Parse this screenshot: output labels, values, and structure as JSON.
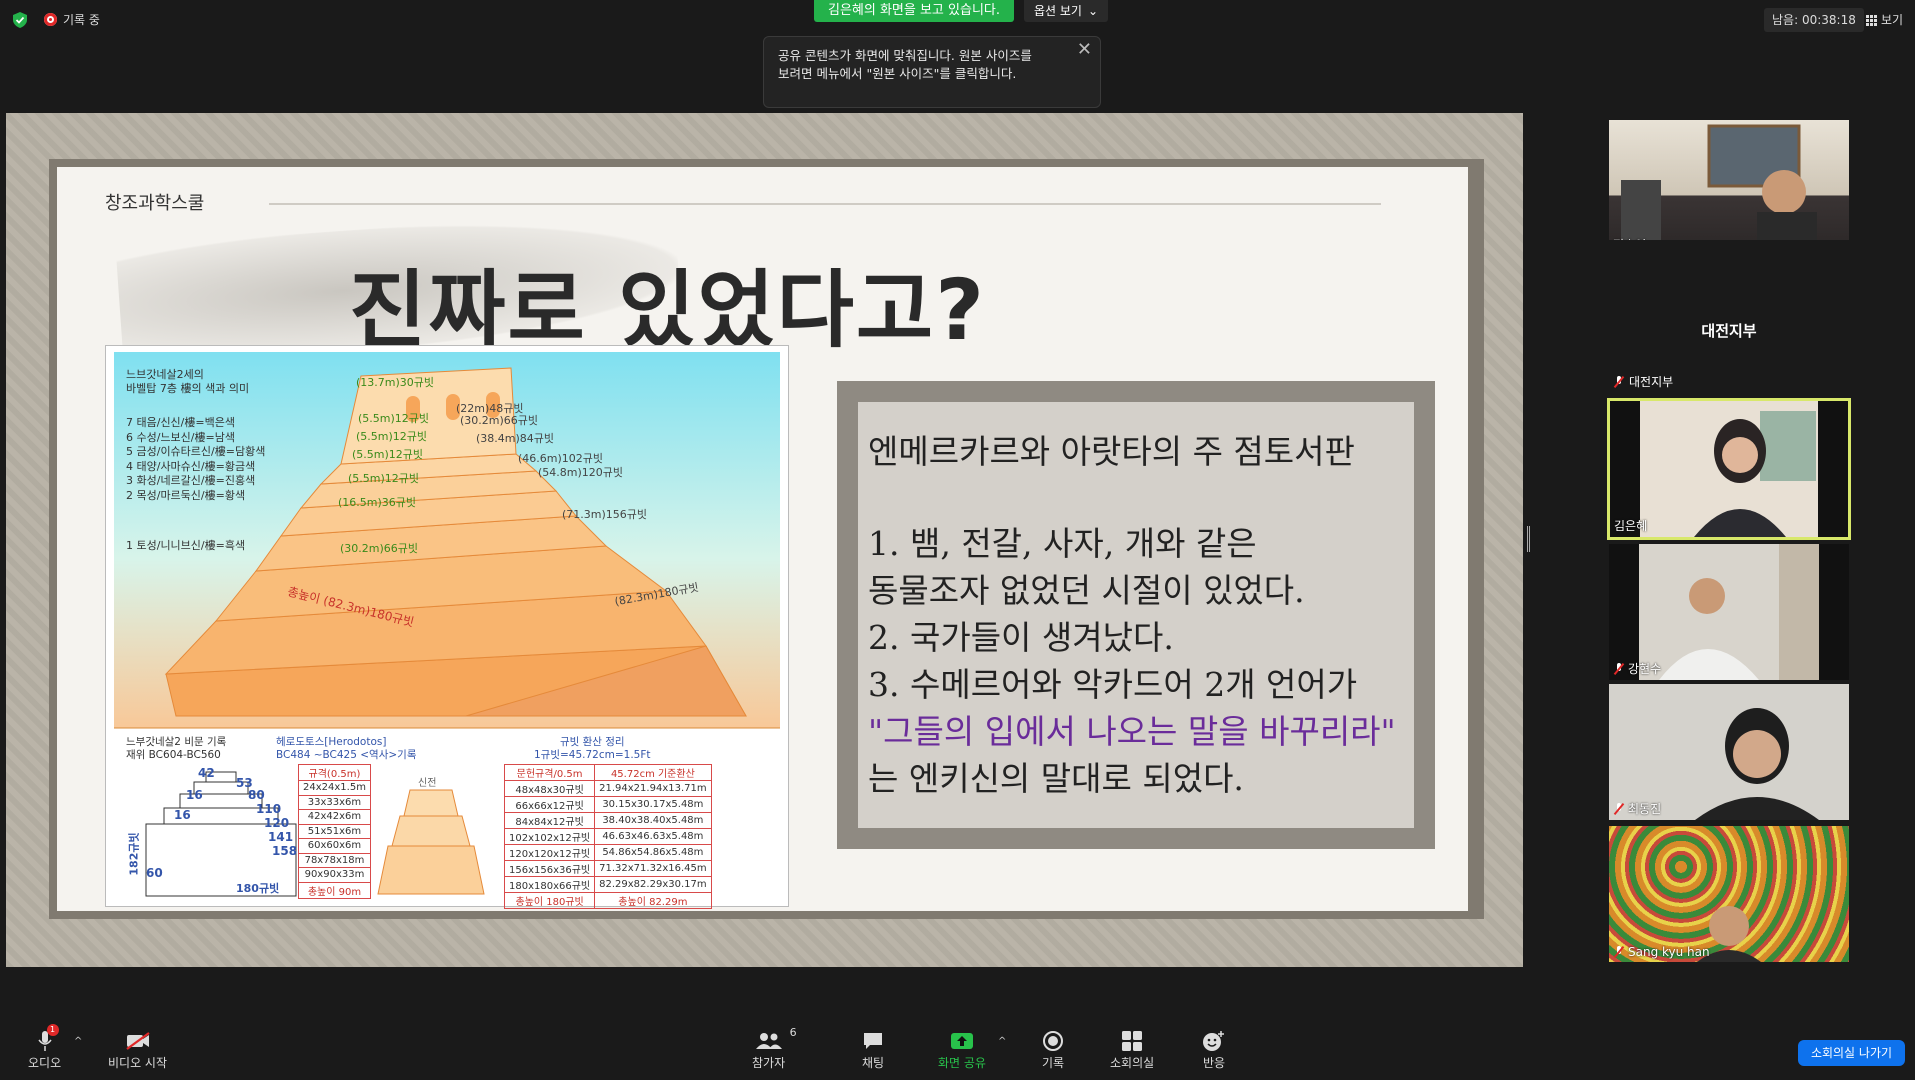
{
  "top": {
    "recording_label": "기록 중",
    "viewing_banner": "김은혜의 화면을 보고 있습니다.",
    "view_options": "옵션 보기",
    "tooltip_line1": "공유 콘텐츠가 화면에 맞춰집니다. 원본 사이즈를",
    "tooltip_line2": "보려면 메뉴에서 \"원본 사이즈\"를 클릭합니다.",
    "timer": "남음: 00:38:18",
    "view_label": "보기"
  },
  "slide": {
    "brand": "창조과학스쿨",
    "title": "진짜로 있었다고?",
    "diagram": {
      "header_line1": "느브갓네살2세의",
      "header_line2": "바벨탑 7층 樓의 색과 의미",
      "legend": [
        "7 태음/신신/樓=백은색",
        "6 수성/느보신/樓=남색",
        "5 금성/이슈타르신/樓=담황색",
        "4 태양/사마슈신/樓=황금색",
        "3 화성/네르갈신/樓=진홍색",
        "2 목성/마르둑신/樓=황색",
        "1 토성/니니브신/樓=흑색"
      ],
      "pyramid_labels": {
        "l7": "(13.7m)30규빗",
        "l6a": "(22m)48규빗",
        "l6b": "(5.5m)12규빗",
        "l5a": "(30.2m)66규빗",
        "l5b": "(5.5m)12규빗",
        "l4a": "(38.4m)84규빗",
        "l4b": "(5.5m)12규빗",
        "l3a": "(46.6m)102규빗",
        "l3b": "(5.5m)12규빗",
        "l2a": "(54.8m)120규빗",
        "l2b": "(16.5m)36규빗",
        "l1a": "(71.3m)156규빗",
        "l1b": "(30.2m)66규빗",
        "base": "(82.3m)180규빗",
        "height": "총높이 (82.3m)180규빗"
      },
      "caption_left_line1": "느부갓네살2 비문 기록",
      "caption_left_line2": "재위 BC604-BC560",
      "caption_mid_line1": "헤로도토스[Herodotos]",
      "caption_mid_line2": "BC484 ~BC425 <역사>기록",
      "caption_right_line1": "규빗 환산 정리",
      "caption_right_line2": "1규빗=45.72cm=1.5Ft",
      "stack_labels": [
        "42",
        "53",
        "80",
        "110",
        "120",
        "141",
        "158",
        "16",
        "16",
        "60",
        "182규빗",
        "180규빗"
      ],
      "shrine_label": "신전",
      "table_mid": {
        "header": "규격(0.5m)",
        "rows": [
          "24x24x1.5m",
          "33x33x6m",
          "42x42x6m",
          "51x51x6m",
          "60x60x6m",
          "78x78x18m",
          "90x90x33m"
        ],
        "footer": "총높이 90m"
      },
      "table_right": {
        "header": [
          "문헌규격/0.5m",
          "45.72cm 기준환산"
        ],
        "rows": [
          [
            "48x48x30규빗",
            "21.94x21.94x13.71m"
          ],
          [
            "66x66x12규빗",
            "30.15x30.17x5.48m"
          ],
          [
            "84x84x12규빗",
            "38.40x38.40x5.48m"
          ],
          [
            "102x102x12규빗",
            "46.63x46.63x5.48m"
          ],
          [
            "120x120x12규빗",
            "54.86x54.86x5.48m"
          ],
          [
            "156x156x36규빗",
            "71.32x71.32x16.45m"
          ],
          [
            "180x180x66규빗",
            "82.29x82.29x30.17m"
          ]
        ],
        "footer": [
          "총높이 180규빗",
          "총높이 82.29m"
        ]
      }
    },
    "textbox": {
      "heading": "엔메르카르와 아랏타의 주 점토서판",
      "l1": "1. 뱀, 전갈, 사자, 개와 같은",
      "l2": "동물조자 없었던 시절이 있었다.",
      "l3": "2. 국가들이 생겨났다.",
      "l4": "3. 수메르어와 악카드어 2개 언어가",
      "l5": "\"그들의 입에서 나오는 말을 바꾸리라\"",
      "l6": "는 엔키신의 말대로 되었다."
    }
  },
  "participants": {
    "p1": "정수연",
    "room_center": "대전지부",
    "room_name": "대전지부",
    "p2": "김은혜",
    "p3": "강현수",
    "p4": "최동진",
    "p5": "Sang kyu han"
  },
  "toolbar": {
    "audio": "오디오",
    "video": "비디오 시작",
    "participants": "참가자",
    "participants_count": "6",
    "chat": "채팅",
    "share": "화면 공유",
    "record": "기록",
    "breakout": "소회의실",
    "reactions": "반응",
    "leave": "소회의실 나가기",
    "audio_badge": "1"
  },
  "colors": {
    "share_green": "#28c24b",
    "banner_green": "#24b24b",
    "leave_blue": "#0e72ed",
    "active_speaker": "#d8e86a"
  }
}
